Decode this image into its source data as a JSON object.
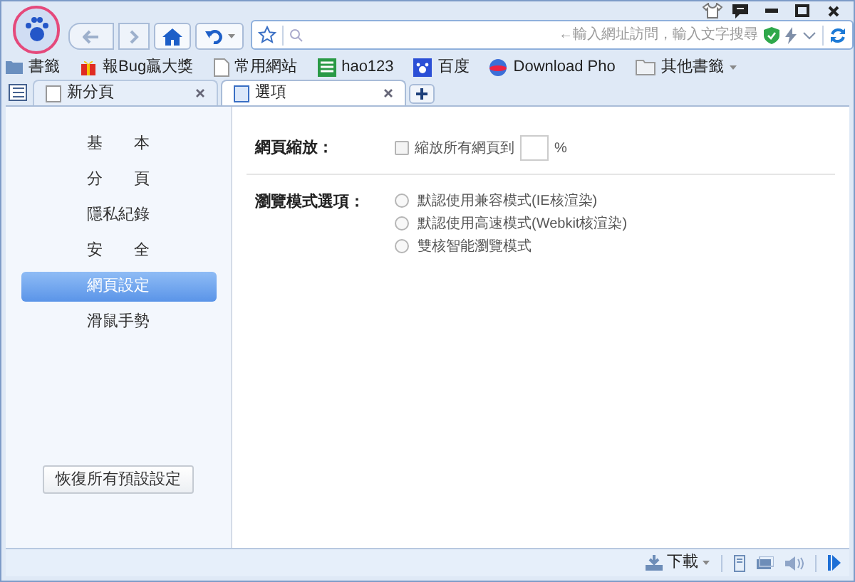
{
  "address_bar": {
    "placeholder": "←輸入網址訪問，輸入文字搜尋"
  },
  "bookmarks": [
    {
      "label": "書籤",
      "kind": "folder"
    },
    {
      "label": "報Bug贏大獎",
      "kind": "gift"
    },
    {
      "label": "常用網站",
      "kind": "page"
    },
    {
      "label": "hao123",
      "kind": "grid"
    },
    {
      "label": "百度",
      "kind": "paw"
    },
    {
      "label": "Download Pho",
      "kind": "globe"
    },
    {
      "label": "其他書籤",
      "kind": "more"
    }
  ],
  "tabs": [
    {
      "label": "新分頁",
      "selected": false
    },
    {
      "label": "選項",
      "selected": true
    }
  ],
  "sidebar": {
    "items": [
      {
        "label": "基　　本",
        "selected": false
      },
      {
        "label": "分　　頁",
        "selected": false
      },
      {
        "label": "隱私紀錄",
        "selected": false
      },
      {
        "label": "安　　全",
        "selected": false
      },
      {
        "label": "網頁設定",
        "selected": true
      },
      {
        "label": "滑鼠手勢",
        "selected": false
      }
    ],
    "reset_button": "恢復所有預設設定"
  },
  "zoom": {
    "label": "網頁縮放：",
    "checkbox_label": "縮放所有網頁到",
    "checked": false,
    "unit": "%"
  },
  "mode": {
    "label": "瀏覽模式選項：",
    "options": [
      {
        "label": "默認使用兼容模式(IE核渲染)",
        "selected": false
      },
      {
        "label": "默認使用高速模式(Webkit核渲染)",
        "selected": false
      },
      {
        "label": "雙核智能瀏覽模式",
        "selected": false
      }
    ]
  },
  "status_bar": {
    "download": "下載"
  }
}
